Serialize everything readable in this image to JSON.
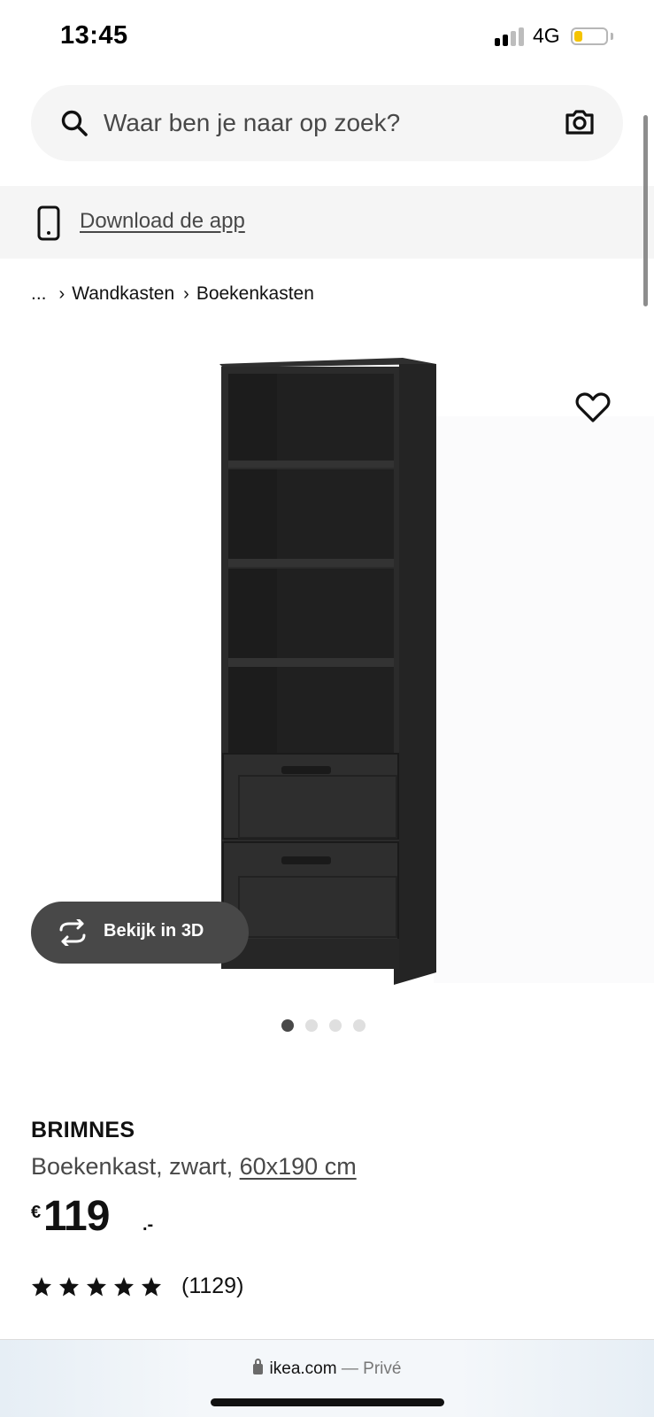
{
  "status_bar": {
    "time": "13:45",
    "network": "4G",
    "battery_level": 0.25,
    "battery_color": "#f5c400",
    "signal_bars_active": 2
  },
  "search": {
    "placeholder": "Waar ben je naar op zoek?",
    "value": "",
    "icon": "search-icon",
    "camera_icon": "camera-icon"
  },
  "app_banner": {
    "icon": "phone-icon",
    "label": "Download de app"
  },
  "breadcrumb": {
    "ellipsis": "...",
    "items": [
      {
        "label": "Wandkasten"
      },
      {
        "label": "Boekenkasten"
      }
    ]
  },
  "gallery": {
    "view3d_label": "Bekijk in 3D",
    "image_count": 4,
    "active_index": 0,
    "favorite_icon": "heart-icon"
  },
  "product": {
    "name": "BRIMNES",
    "description": "Boekenkast, zwart, ",
    "size": "60x190 cm",
    "price": {
      "currency": "€",
      "amount": "119",
      "suffix": ".-"
    },
    "rating": 5,
    "review_count": "(1129)"
  },
  "browser": {
    "domain": "ikea.com",
    "separator": " — ",
    "mode": "Privé"
  },
  "colors": {
    "text": "#111111",
    "muted": "#484848",
    "surface": "#f5f5f5",
    "accent_dark": "#484848"
  }
}
